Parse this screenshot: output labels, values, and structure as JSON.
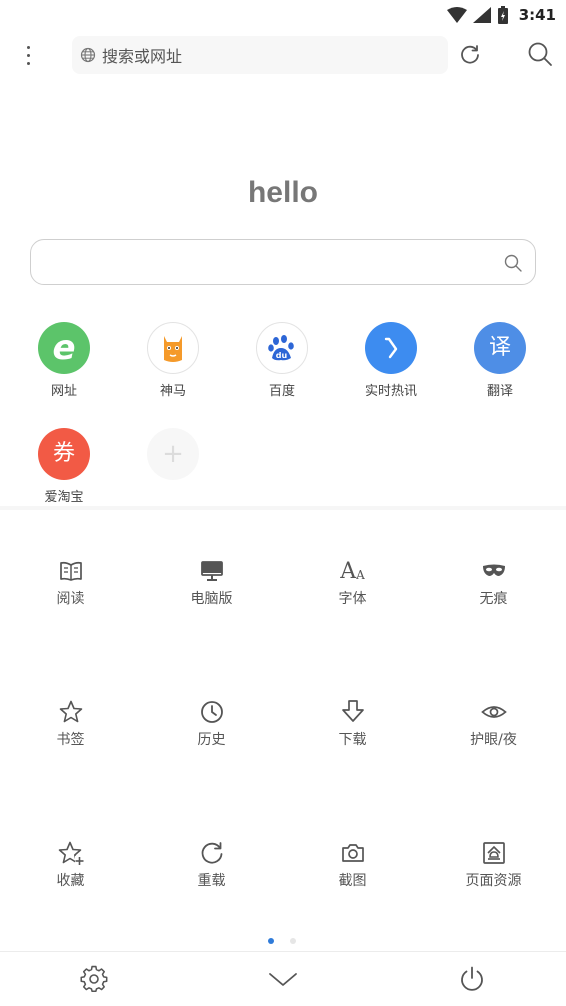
{
  "status_bar": {
    "time": "3:41"
  },
  "toolbar": {
    "address_placeholder": "搜索或网址"
  },
  "home": {
    "greeting": "hello"
  },
  "quick_links": [
    {
      "label": "网址",
      "icon": "e-icon",
      "color": "#5cc46a"
    },
    {
      "label": "神马",
      "icon": "shenma-alpaca-icon",
      "color": "#ffffff"
    },
    {
      "label": "百度",
      "icon": "baidu-paw-icon",
      "color": "#ffffff"
    },
    {
      "label": "实时热讯",
      "icon": "arrow-icon",
      "color": "#3d8cf0"
    },
    {
      "label": "翻译",
      "icon": "translate-icon",
      "glyph": "译",
      "color": "#4e8ee6"
    },
    {
      "label": "爱淘宝",
      "icon": "coupon-icon",
      "glyph": "券",
      "color": "#f25a45"
    },
    {
      "label": "",
      "icon": "add-icon",
      "glyph": "+",
      "color": "#f7f7f7"
    }
  ],
  "menu": [
    {
      "label": "阅读",
      "icon": "book-icon"
    },
    {
      "label": "电脑版",
      "icon": "desktop-icon"
    },
    {
      "label": "字体",
      "icon": "font-icon",
      "glyph": "A"
    },
    {
      "label": "无痕",
      "icon": "mask-icon"
    },
    {
      "label": "书签",
      "icon": "star-icon"
    },
    {
      "label": "历史",
      "icon": "clock-icon"
    },
    {
      "label": "下载",
      "icon": "download-icon"
    },
    {
      "label": "护眼/夜",
      "icon": "eye-icon"
    },
    {
      "label": "收藏",
      "icon": "star-plus-icon"
    },
    {
      "label": "重载",
      "icon": "reload-icon"
    },
    {
      "label": "截图",
      "icon": "camera-icon"
    },
    {
      "label": "页面资源",
      "icon": "page-resource-icon"
    }
  ],
  "colors": {
    "accent": "#2f7bd9",
    "dot_inactive": "#e6e6e6",
    "icon_gray": "#555555"
  }
}
